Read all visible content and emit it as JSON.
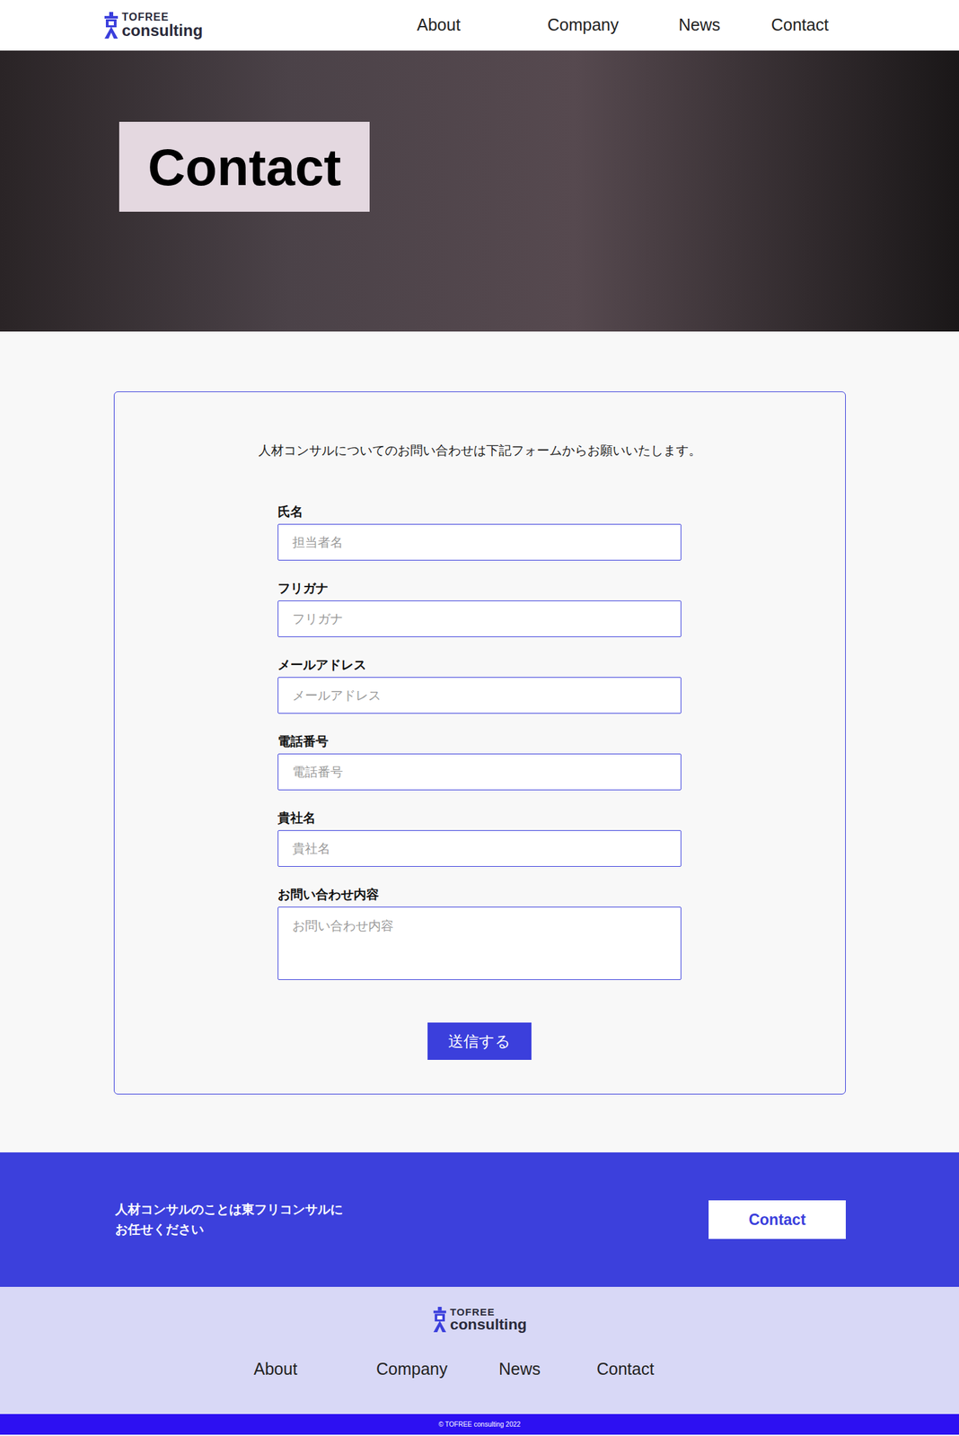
{
  "header": {
    "logo": {
      "top": "TOFREE",
      "bottom": "consulting"
    },
    "nav": [
      "About",
      "Company",
      "News",
      "Contact"
    ]
  },
  "hero": {
    "title": "Contact"
  },
  "form": {
    "intro": "人材コンサルについてのお問い合わせは下記フォームからお願いいたします。",
    "fields": [
      {
        "label": "氏名",
        "placeholder": "担当者名",
        "kind": "input"
      },
      {
        "label": "フリガナ",
        "placeholder": "フリガナ",
        "kind": "input"
      },
      {
        "label": "メールアドレス",
        "placeholder": "メールアドレス",
        "kind": "input"
      },
      {
        "label": "電話番号",
        "placeholder": "電話番号",
        "kind": "input"
      },
      {
        "label": "貴社名",
        "placeholder": "貴社名",
        "kind": "input"
      },
      {
        "label": "お問い合わせ内容",
        "placeholder": "お問い合わせ内容",
        "kind": "textarea"
      }
    ],
    "submit": "送信する"
  },
  "cta": {
    "lines": [
      "人材コンサルのことは東フリコンサルに",
      "お任せください"
    ],
    "button": "Contact"
  },
  "footer": {
    "logo": {
      "top": "TOFREE",
      "bottom": "consulting"
    },
    "nav": [
      "About",
      "Company",
      "News",
      "Contact"
    ],
    "copyright": "© TOFREE consulting 2022"
  }
}
